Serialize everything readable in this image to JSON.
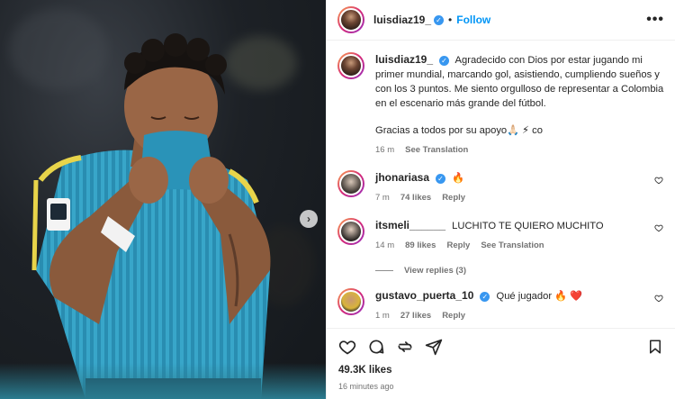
{
  "post": {
    "username": "luisdiaz19_",
    "follow_label": "Follow",
    "separator": "•",
    "more_label": "•••"
  },
  "caption": {
    "username": "luisdiaz19_",
    "text": "Agradecido con Dios por estar jugando mi primer mundial, marcando gol, asistiendo, cumpliendo sueños y con los 3 puntos. Me siento orgulloso de representar a Colombia en el escenario más grande del fútbol.",
    "text2": "Gracias a todos por su apoyo🙏🏻 ⚡ co",
    "time": "16 m",
    "see_translation": "See Translation"
  },
  "comments": [
    {
      "username": "jhonariasa",
      "text": "🔥",
      "time": "7 m",
      "likes": "74 likes",
      "reply": "Reply"
    },
    {
      "username": "itsmeli______",
      "text": "LUCHITO TE QUIERO MUCHITO",
      "time": "14 m",
      "likes": "89 likes",
      "reply": "Reply",
      "see_translation": "See Translation",
      "view_replies": "View replies (3)"
    },
    {
      "username": "gustavo_puerta_10",
      "text": "Qué jugador 🔥 ❤️",
      "time": "1 m",
      "likes": "27 likes",
      "reply": "Reply"
    }
  ],
  "stats": {
    "likes": "49.3K likes",
    "posted": "16 minutes ago"
  },
  "colors": {
    "accent": "#0095f6",
    "verified": "#3897f0",
    "jersey": "#2b9fc4",
    "jersey_trim": "#e8d44a"
  },
  "icons": [
    "heart-icon",
    "comment-icon",
    "share-icon",
    "send-icon",
    "bookmark-icon",
    "chevron-right-icon",
    "more-icon"
  ]
}
